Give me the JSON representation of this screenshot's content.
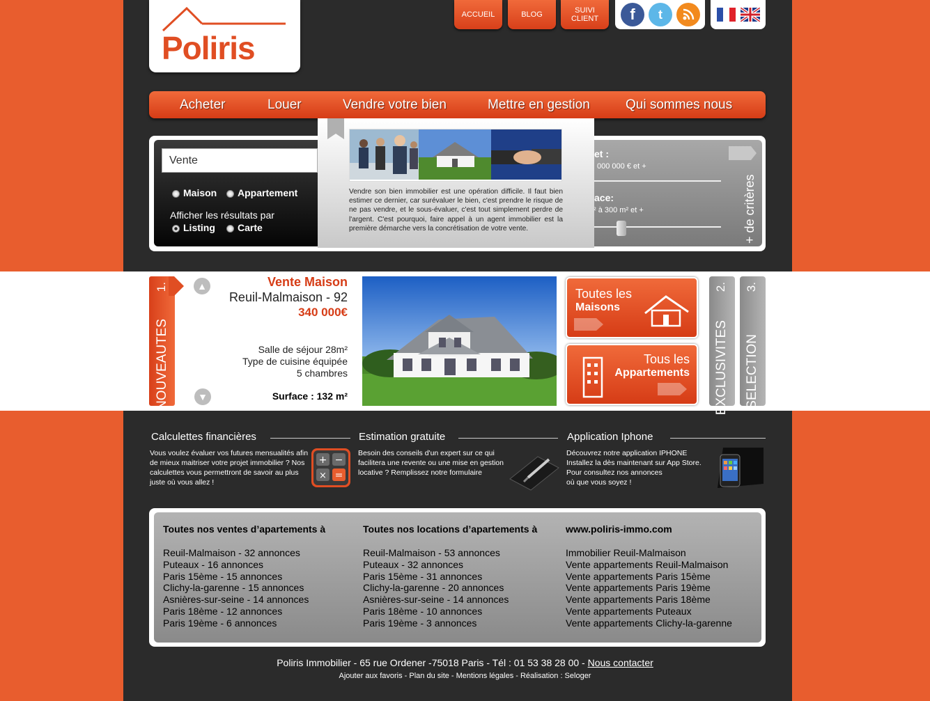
{
  "logo": {
    "text": "Poliris"
  },
  "top_nav": {
    "accueil": "ACCUEIL",
    "blog": "BLOG",
    "suivi_line1": "SUIVI",
    "suivi_line2": "CLIENT"
  },
  "main_nav": [
    "Acheter",
    "Louer",
    "Vendre votre bien",
    "Mettre en gestion",
    "Qui sommes nous"
  ],
  "search": {
    "input_value": "Vente",
    "type_options": [
      "Maison",
      "Appartement"
    ],
    "display_label": "Afficher les résultats par",
    "display_options": [
      "Listing",
      "Carte"
    ],
    "criteria_1_label": "et :",
    "criteria_1_value": "000 000 € et +",
    "criteria_2_label": "ace:",
    "criteria_2_value": "² à 300 m² et +",
    "more_criteria": "+ de critères"
  },
  "popup": {
    "text": "Vendre son bien immobilier est une opération difficile. Il faut bien estimer ce dernier, car surévaluer le bien, c'est prendre le risque de ne pas vendre, et le sous-évaluer, c'est tout simplement perdre de l'argent. C'est pourquoi, faire appel à un agent immobilier est la première démarche vers la concrétisation de votre vente."
  },
  "nouveautes": {
    "tab_number": "1.",
    "tab_label": "NOUVEAUTES",
    "title": "Vente Maison",
    "location": "Reuil-Malmaison - 92",
    "price": "340 000€",
    "details": [
      "Salle de séjour 28m²",
      "Type de cuisine équipée",
      "5 chambres"
    ],
    "surface": "Surface : 132 m²"
  },
  "promos": {
    "maisons_line1": "Toutes les",
    "maisons_line2": "Maisons",
    "apparts_line1": "Tous les",
    "apparts_line2": "Appartements"
  },
  "side_tabs": [
    {
      "number": "2.",
      "label": "EXCLUSIVITES"
    },
    {
      "number": "3.",
      "label": "SELECTION"
    }
  ],
  "info": {
    "calc_title": "Calculettes financières",
    "calc_text": "Vous voulez évaluer vos futures mensualités afin de mieux maitriser votre projet immobilier ? Nos calculettes vous permettront de savoir au plus juste où vous allez !",
    "estim_title": "Estimation gratuite",
    "estim_text": "Besoin des conseils d'un expert sur ce qui facilitera une revente ou une mise en gestion locative ? Remplissez notre formulaire",
    "app_title": "Application Iphone",
    "app_text_lines": [
      "Découvrez notre application IPHONE",
      "Installez la dès maintenant sur App Store.",
      "Pour consultez nos annonces",
      "où que vous soyez !"
    ]
  },
  "lists": {
    "ventes_title": "Toutes nos ventes d’apartements à",
    "ventes": [
      "Reuil-Malmaison - 32 annonces",
      "Puteaux - 16 annonces",
      "Paris 15ème - 15 annonces",
      "Clichy-la-garenne - 15 annonces",
      "Asnières-sur-seine - 14 annonces",
      "Paris 18ème - 12 annonces",
      "Paris 19ème - 6 annonces"
    ],
    "locations_title": "Toutes nos locations d’apartements à",
    "locations": [
      "Reuil-Malmaison - 53 annonces",
      "Puteaux - 32 annonces",
      "Paris 15ème - 31 annonces",
      "Clichy-la-garenne - 20 annonces",
      "Asnières-sur-seine - 14 annonces",
      "Paris 18ème - 10 annonces",
      "Paris 19ème - 3 annonces"
    ],
    "site_title": "www.poliris-immo.com",
    "site_links": [
      "Immobilier Reuil-Malmaison",
      "Vente appartements Reuil-Malmaison",
      "Vente appartements Paris 15ème",
      "Vente appartements Paris 19ème",
      "Vente appartements Paris 18ème",
      "Vente appartements Puteaux",
      "Vente appartements Clichy-la-garenne"
    ]
  },
  "footer": {
    "address": "Poliris Immobilier - 65 rue Ordener -75018 Paris - Tél : 01 53 38 28 00 - ",
    "contact": "Nous contacter",
    "links": "Ajouter aux favoris - Plan du site - Mentions légales - Réalisation : Seloger"
  }
}
